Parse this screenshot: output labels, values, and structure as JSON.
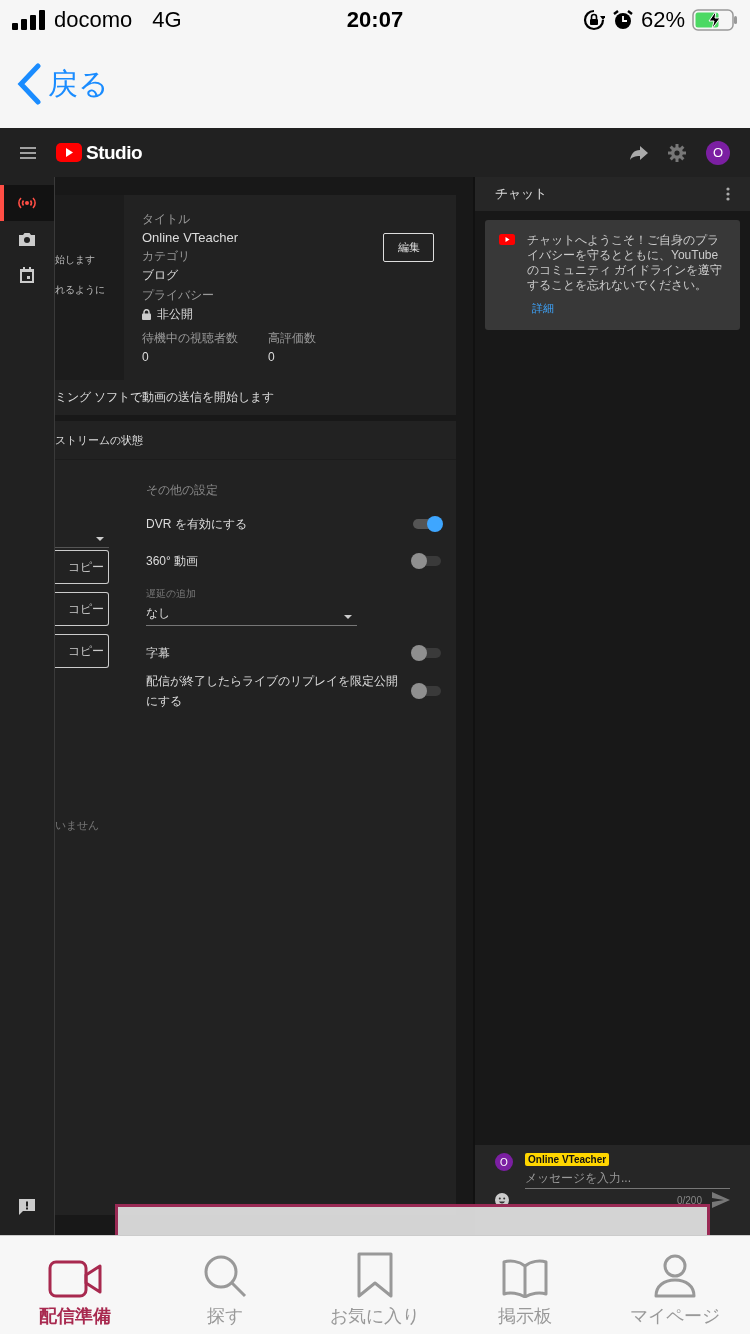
{
  "status_bar": {
    "carrier": "docomo",
    "network": "4G",
    "time": "20:07",
    "battery": "62%"
  },
  "nav": {
    "back": "戻る"
  },
  "studio": {
    "logo": "Studio",
    "avatar": "O"
  },
  "rail": [
    {
      "kind": "live",
      "selected": true
    },
    {
      "kind": "camera",
      "selected": false
    },
    {
      "kind": "calendar",
      "selected": false
    }
  ],
  "stream_card": {
    "left_lines": [
      "始します",
      "れるように"
    ],
    "edit_button": "編集",
    "fields": [
      {
        "label": "タイトル",
        "value": "Online VTeacher",
        "kind": "text"
      },
      {
        "label": "カテゴリ",
        "value": "ブログ",
        "kind": "text"
      },
      {
        "label": "プライバシー",
        "value": "非公開",
        "kind": "lock"
      }
    ],
    "stats": [
      {
        "label": "待機中の視聴者数",
        "value": "0"
      },
      {
        "label": "高評価数",
        "value": "0"
      }
    ]
  },
  "instruction": "ミング ソフトで動画の送信を開始します",
  "status_card": {
    "heading": "ストリームの状態",
    "copy_buttons": [
      "コピー",
      "コピー",
      "コピー"
    ],
    "note": "いません",
    "settings_heading": "その他の設定",
    "settings": [
      {
        "kind": "toggle",
        "label": "DVR を有効にする",
        "on": true
      },
      {
        "kind": "toggle",
        "label": "360° 動画",
        "on": false
      },
      {
        "kind": "select",
        "label": "遅延の追加",
        "value": "なし"
      },
      {
        "kind": "toggle",
        "label": "字幕",
        "on": false
      },
      {
        "kind": "toggle",
        "label": "配信が終了したらライブのリプレイを限定公開にする",
        "on": false
      }
    ]
  },
  "chat": {
    "title": "チャット",
    "welcome": "チャットへようこそ！ご自身のプライバシーを守るとともに、YouTube のコミュニティ ガイドラインを遵守することを忘れないでください。",
    "link": "詳細",
    "avatar": "O",
    "author": "Online VTeacher",
    "placeholder": "メッセージを入力...",
    "counter": "0/200"
  },
  "tabs": [
    {
      "kind": "video",
      "label": "配信準備",
      "selected": true
    },
    {
      "kind": "search",
      "label": "探す",
      "selected": false
    },
    {
      "kind": "bookmark",
      "label": "お気に入り",
      "selected": false
    },
    {
      "kind": "book",
      "label": "掲示板",
      "selected": false
    },
    {
      "kind": "person",
      "label": "マイページ",
      "selected": false
    }
  ]
}
